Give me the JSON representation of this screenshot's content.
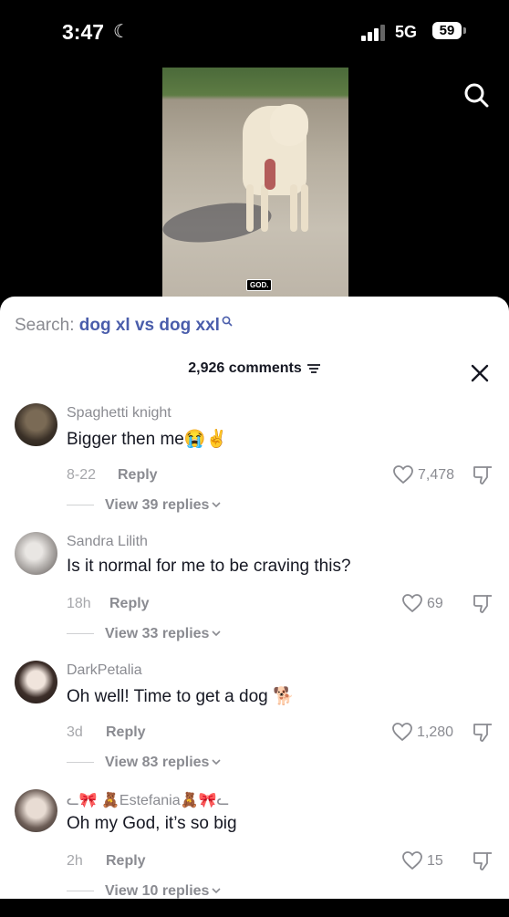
{
  "status": {
    "time": "3:47",
    "network": "5G",
    "battery": "59"
  },
  "video": {
    "caption": "GOD."
  },
  "search": {
    "prefix": "Search: ",
    "query": "dog xl vs dog xxl"
  },
  "comments_header": {
    "count_label": "2,926 comments"
  },
  "comments": [
    {
      "username": "Spaghetti knight",
      "text": "Bigger then me😭✌️",
      "date": "8-22",
      "reply": "Reply",
      "likes": "7,478",
      "view_replies": "View 39 replies"
    },
    {
      "username": "Sandra Lilith",
      "text": "Is it normal for me to be craving this?",
      "date": "18h",
      "reply": "Reply",
      "likes": "69",
      "view_replies": "View 33 replies"
    },
    {
      "username": "DarkPetalia",
      "text": "Oh well! Time to get a dog 🐕",
      "date": "3d",
      "reply": "Reply",
      "likes": "1,280",
      "view_replies": "View 83 replies"
    },
    {
      "username": "ᓚ🎀 🧸Estefania🧸🎀ᓚ",
      "text": "Oh my God, it’s so big",
      "date": "2h",
      "reply": "Reply",
      "likes": "15",
      "view_replies": "View 10 replies"
    }
  ]
}
